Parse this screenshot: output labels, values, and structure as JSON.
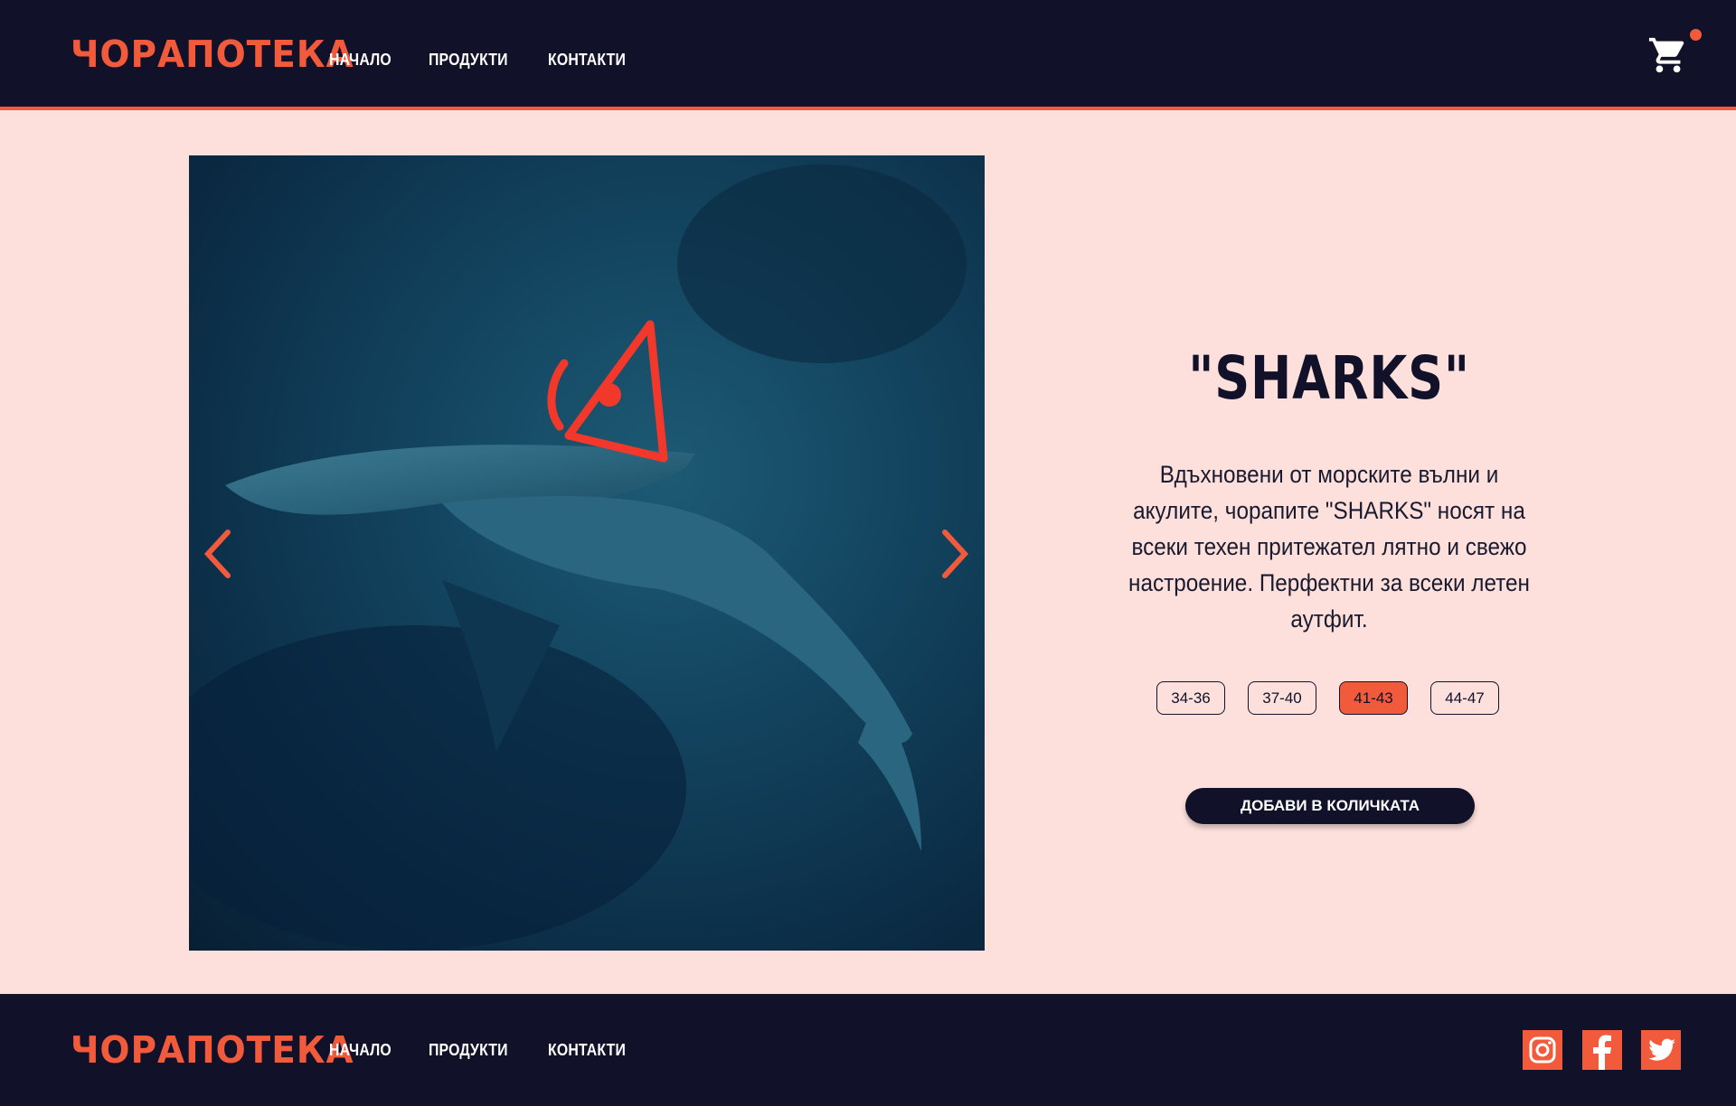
{
  "brand": {
    "logo": "ЧОРАПОТЕКА",
    "accent": "#f25a3c",
    "dark": "#11112a",
    "background": "#fde0dc"
  },
  "nav": {
    "items": [
      "НАЧАЛО",
      "ПРОДУКТИ",
      "КОНТАКТИ"
    ]
  },
  "header": {
    "cart_icon": "cart-icon",
    "cart_has_items": true
  },
  "product": {
    "title": "\"SHARKS\"",
    "description": "Вдъхновени от морските вълни и акулите, чорапите \"SHARKS\" носят на всеки техен притежател лятно и свежо настроение. Перфектни за всеки летен аутфит.",
    "sizes": [
      "34-36",
      "37-40",
      "41-43",
      "44-47"
    ],
    "selected_size": "41-43",
    "add_to_cart": "ДОБАВИ В КОЛИЧКАТА"
  },
  "footer": {
    "logo": "ЧОРАПОТЕКА",
    "nav": [
      "НАЧАЛО",
      "ПРОДУКТИ",
      "КОНТАКТИ"
    ],
    "social": [
      "instagram-icon",
      "facebook-icon",
      "twitter-icon"
    ]
  }
}
